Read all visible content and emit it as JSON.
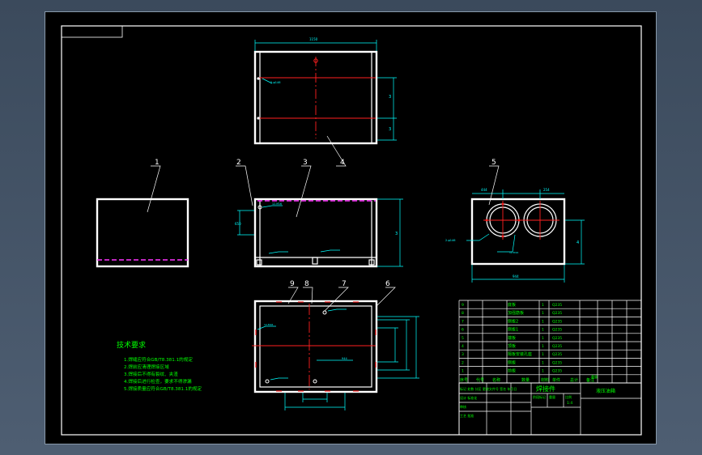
{
  "part_labels": [
    "1",
    "2",
    "3",
    "4",
    "5",
    "6",
    "7",
    "8",
    "9"
  ],
  "dims": {
    "top_width": "1150",
    "side_a": "3",
    "side_b": "3",
    "front_h1": "650",
    "front_h2": "3",
    "right_w1": "444",
    "right_w2": "254",
    "right_total": "944",
    "right_h": "4",
    "bottom_inner": "944",
    "hole_note": "2-φ146",
    "hole_note2": "12-M16"
  },
  "tech": {
    "title": "技术要求",
    "lines": [
      "1.焊缝应符合GB/T8.381.1的规定",
      "2.焊前应清理焊接区域",
      "3.焊接后不得有裂纹、夹渣",
      "4.焊接后进行检查，要求不得渗漏",
      "5.焊接质量应符合GB/T8.381.1的规定"
    ]
  },
  "bom": {
    "rows": [
      {
        "no": "9",
        "name": "底板",
        "qty": "1",
        "mat": "Q235"
      },
      {
        "no": "8",
        "name": "加强筋板",
        "qty": "1",
        "mat": "Q235"
      },
      {
        "no": "7",
        "name": "侧板2",
        "qty": "1",
        "mat": "Q235"
      },
      {
        "no": "6",
        "name": "侧板1",
        "qty": "1",
        "mat": "Q235"
      },
      {
        "no": "5",
        "name": "端板",
        "qty": "1",
        "mat": "Q235"
      },
      {
        "no": "4",
        "name": "顶板",
        "qty": "1",
        "mat": "Q235"
      },
      {
        "no": "3",
        "name": "隔板安装孔座",
        "qty": "1",
        "mat": "Q235"
      },
      {
        "no": "2",
        "name": "侧板",
        "qty": "1",
        "mat": "Q235"
      },
      {
        "no": "1",
        "name": "前板",
        "qty": "1",
        "mat": "Q235"
      }
    ],
    "header": [
      "序号",
      "代号",
      "名称",
      "数量",
      "材料",
      "单件",
      "总计",
      "备注"
    ],
    "header_extra": "重量"
  },
  "title_block": {
    "part_name": "焊接件",
    "drawing_name": "液压油箱",
    "row_labels": [
      "标记 处数 分区 更改文件号 签名 年月日",
      "设计 标准化",
      "审核",
      "工艺 批准"
    ],
    "scale_labels": [
      "阶段标记",
      "重量",
      "比例"
    ],
    "scale": "1:4"
  }
}
